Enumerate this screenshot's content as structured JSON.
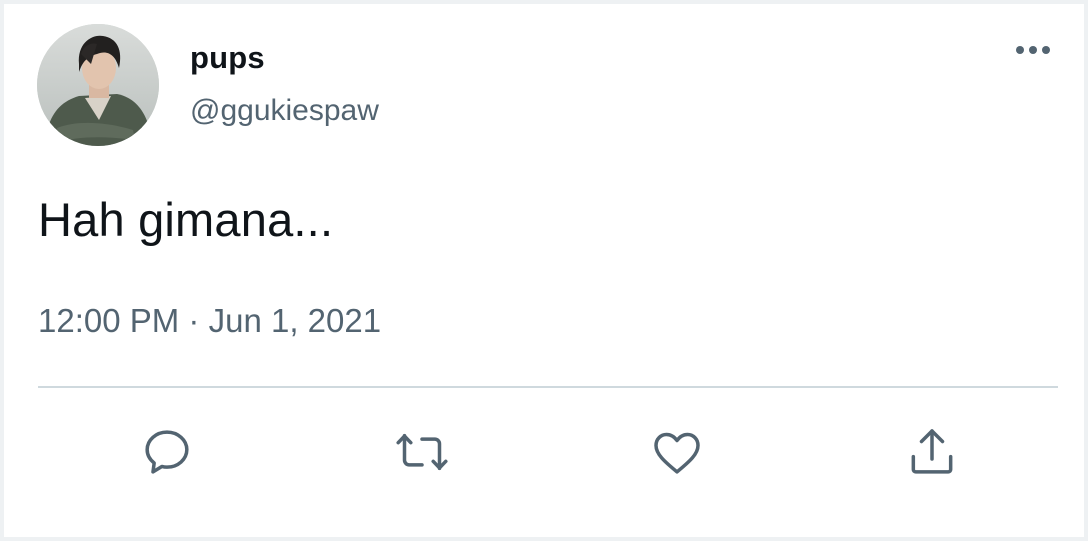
{
  "tweet": {
    "display_name": "pups",
    "handle": "@ggukiespaw",
    "text": "Hah gimana...",
    "time": "12:00 PM",
    "separator": "·",
    "date": "Jun 1, 2021"
  },
  "actions": [
    {
      "name": "reply",
      "icon": "reply-icon"
    },
    {
      "name": "retweet",
      "icon": "retweet-icon"
    },
    {
      "name": "like",
      "icon": "heart-icon"
    },
    {
      "name": "share",
      "icon": "share-icon"
    }
  ],
  "colors": {
    "primary_text": "#0f1419",
    "secondary_text": "#536471",
    "divider": "#cfd9de",
    "icon": "#536471"
  }
}
